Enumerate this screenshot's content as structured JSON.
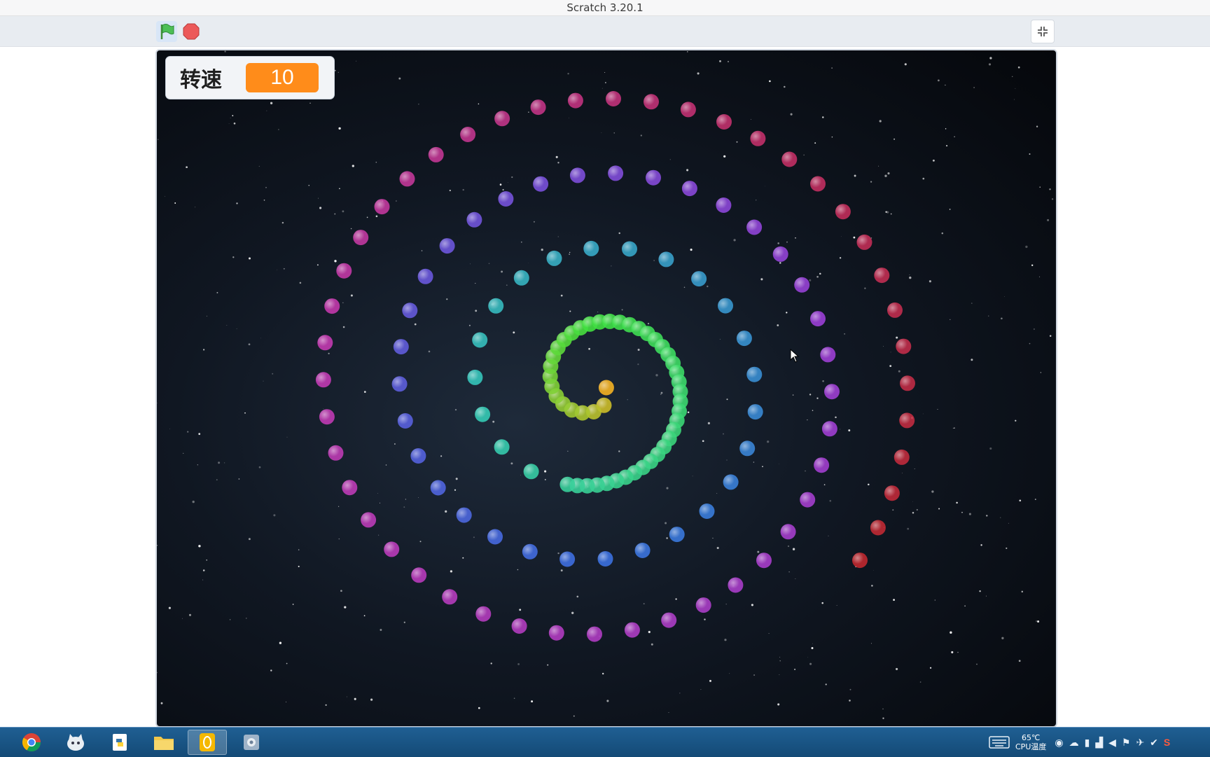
{
  "window": {
    "title": "Scratch 3.20.1"
  },
  "toolbar": {
    "green_flag_icon": "green-flag-icon",
    "stop_icon": "stop-icon",
    "fullscreen_icon": "exit-fullscreen-icon"
  },
  "stage": {
    "variable_monitor": {
      "label": "转速",
      "value": "10"
    },
    "spiral_colors": {
      "inner": "#ffb020",
      "green": "#40e040",
      "teal": "#35c9b8",
      "blue": "#3b6fe0",
      "purple": "#9b3fd6",
      "magenta": "#c23ab0",
      "red": "#c0282e"
    }
  },
  "taskbar": {
    "apps": [
      "chrome-icon",
      "scratch-cat-icon",
      "python-icon",
      "file-explorer-icon",
      "notes-app-icon",
      "settings-app-icon"
    ],
    "tray": {
      "temperature": "65℃",
      "temperature_label": "CPU温度"
    }
  }
}
